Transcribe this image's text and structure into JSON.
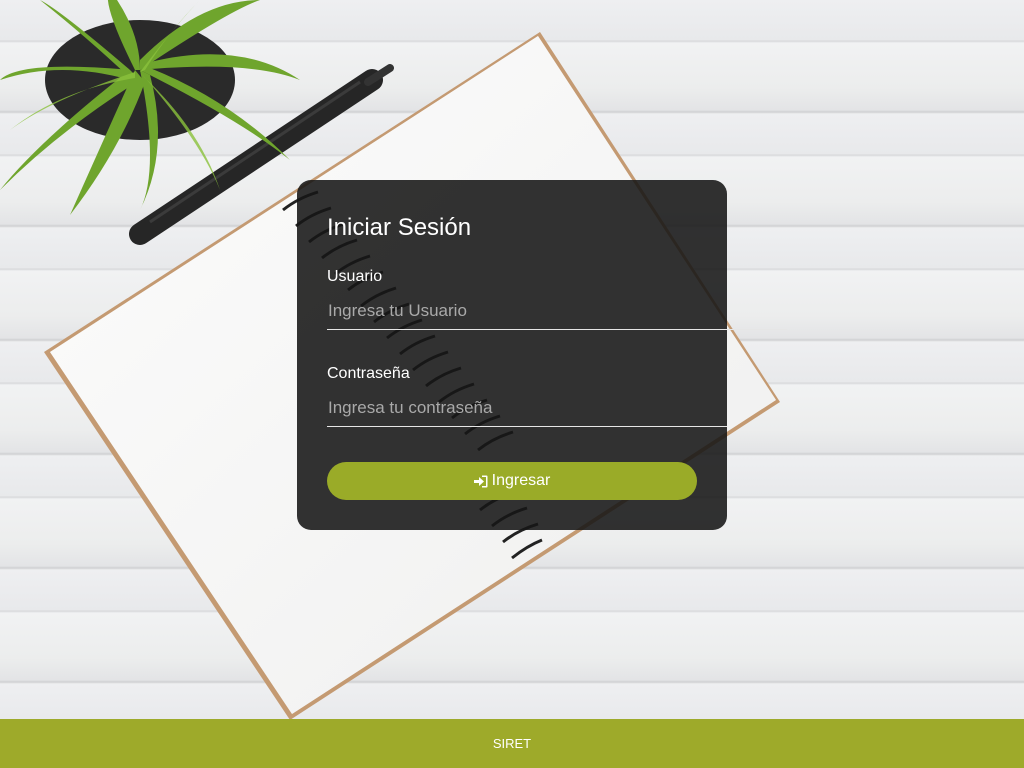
{
  "login": {
    "title": "Iniciar Sesión",
    "username_label": "Usuario",
    "username_placeholder": "Ingresa tu Usuario",
    "password_label": "Contraseña",
    "password_placeholder": "Ingresa tu contraseña",
    "submit_label": "Ingresar",
    "submit_icon": "sign-in-icon"
  },
  "footer": {
    "text": "SIRET"
  },
  "colors": {
    "accent": "#9eaa2a",
    "card_background": "#161616",
    "footer_background": "#9eaa2a"
  }
}
